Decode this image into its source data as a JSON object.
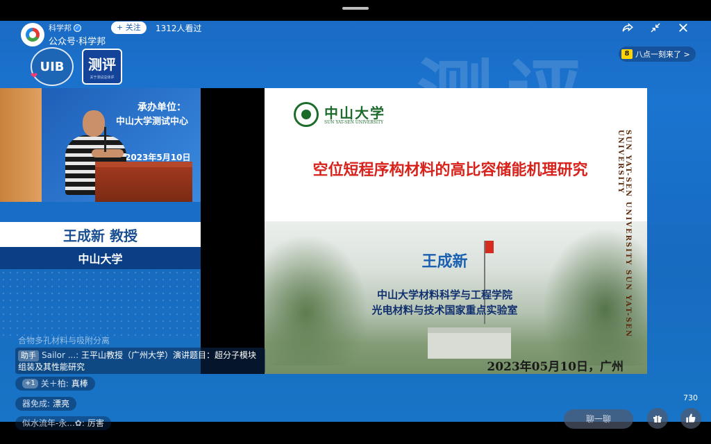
{
  "header": {
    "account_name": "科学邦",
    "account_sub": "公众号·科学邦",
    "follow_label": "+ 关注",
    "viewers": "1312人看过",
    "promo_label": "八点一刻来了 >",
    "promo_icon_text": "8"
  },
  "event": {
    "logo1": "UIB",
    "logo2_title": "测评",
    "logo2_sub": "关于测试总体评"
  },
  "speaker": {
    "banner_line1": "承办单位：",
    "banner_line2": "中山大学测试中心",
    "banner_date": "2023年5月10日",
    "name": "王成新 教授",
    "affiliation": "中山大学"
  },
  "slide": {
    "university_cn": "中山大学",
    "university_en": "SUN YAT-SEN UNIVERSITY",
    "vertical_text": "SUN YAT-SEN UNIVERSITY  SUN YAT-SEN UNIVERSITY",
    "title": "空位短程序构材料的高比容储能机理研究",
    "author": "王成新",
    "institution1": "中山大学材料科学与工程学院",
    "institution2": "光电材料与技术国家重点实验室",
    "date": "2023年05月10日，广州"
  },
  "comments": {
    "faded": "合物多孔材料与吸附分离",
    "assistant_tag": "助手",
    "assistant_user": "Sailor ...:",
    "assistant_text": "王平山教授（广州大学）演讲题目：超分子模块组装及其性能研究",
    "c1_plus": "+1",
    "c1_user": "关＋柏:",
    "c1_text": "真棒",
    "c2_user": "器免成:",
    "c2_text": "漂亮",
    "c3_user": "似水流年-永...✿:",
    "c3_text": "厉害"
  },
  "controls": {
    "like_count": "730",
    "chat_placeholder": "聊一聊"
  },
  "icons": [
    "share-icon",
    "shrink-icon",
    "close-icon",
    "gift-icon",
    "thumbs-up-icon",
    "verified-icon",
    "heart-icon"
  ],
  "colors": {
    "stage_blue": "#1a6bc4",
    "title_red": "#d7231c",
    "author_blue": "#1a5fb0",
    "sysu_green": "#1c6b2b"
  }
}
